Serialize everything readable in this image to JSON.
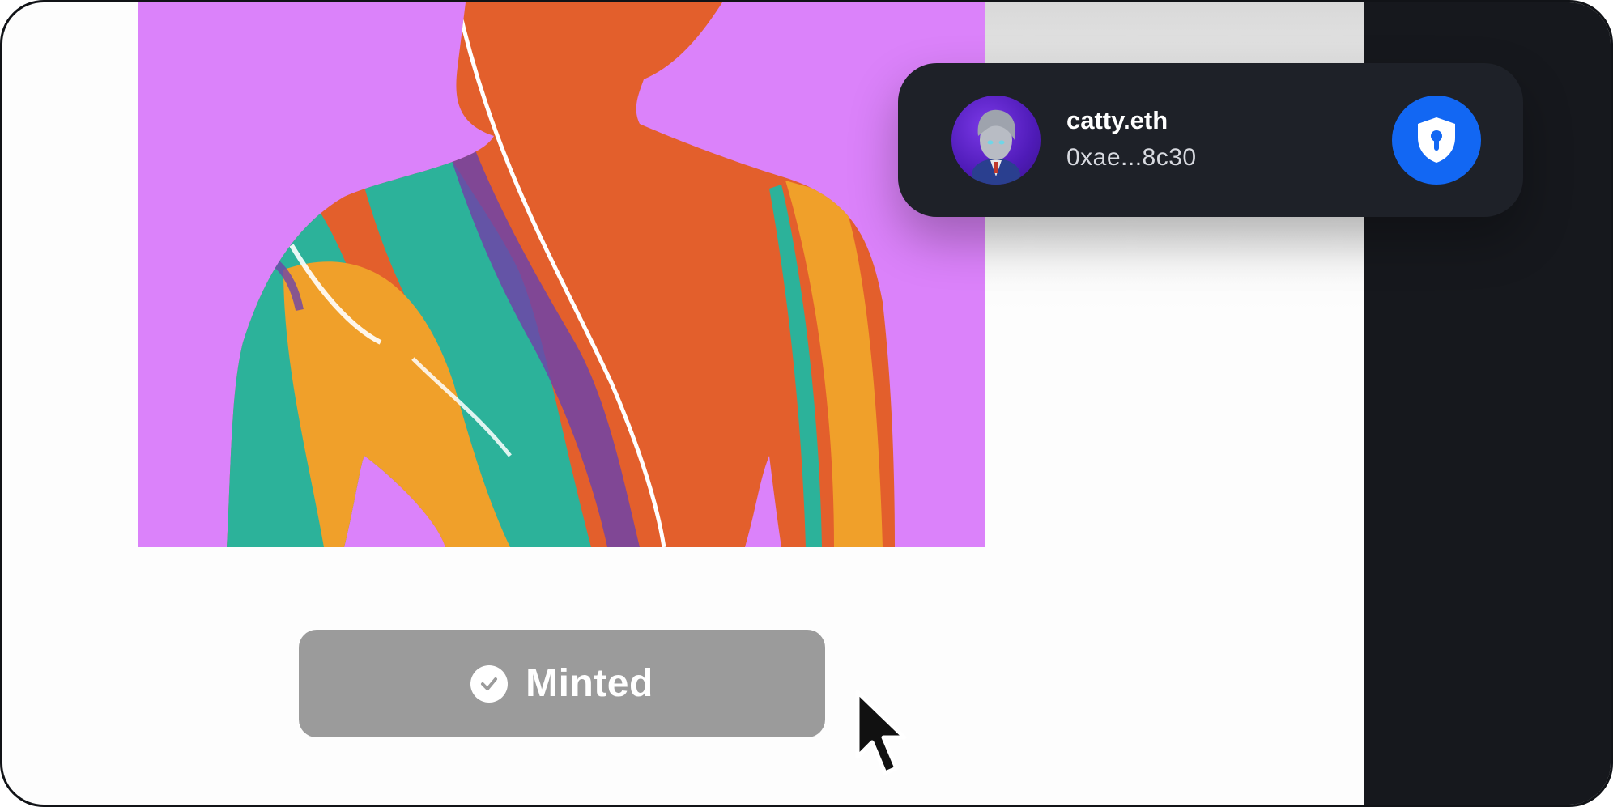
{
  "artwork": {
    "icon": "nft-artwork-image",
    "background_color": "#db82fa"
  },
  "mint_button": {
    "label": "Minted",
    "icon": "check-circle-icon",
    "color": "#9b9b9b"
  },
  "wallet": {
    "name": "catty.eth",
    "address": "0xae...8c30",
    "avatar_icon": "avatar-icon",
    "security_icon": "shield-keyhole-icon",
    "accent": "#1267f3"
  }
}
